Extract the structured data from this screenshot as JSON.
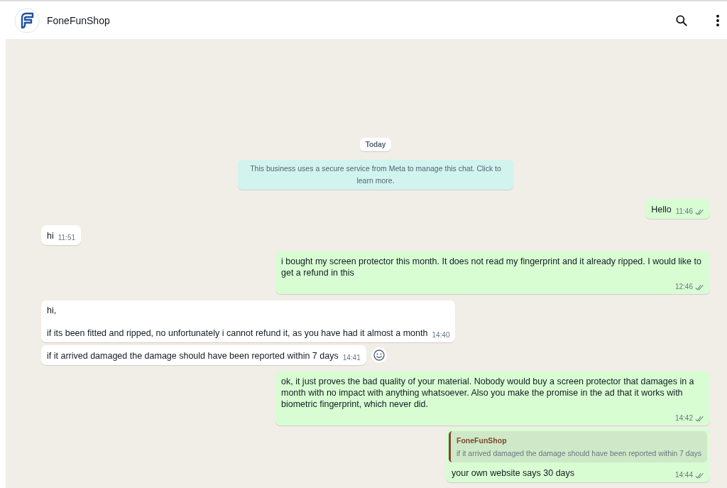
{
  "header": {
    "name": "FoneFunShop"
  },
  "date_chip": "Today",
  "notice": "This business uses a secure service from Meta to manage this chat. Click to learn more.",
  "messages": [
    {
      "kind": "sent",
      "text": "Hello",
      "time": "11:46",
      "read": true
    },
    {
      "kind": "received",
      "text": "hi",
      "time": "11:51"
    },
    {
      "kind": "sent",
      "text": "i bought my screen protector this month. It does not read my fingerprint and it already ripped. I would like to get a refund in this",
      "time": "12:46",
      "read": true
    },
    {
      "kind": "received",
      "text": "hi,\n\nif its been fitted and ripped, no unfortunately i cannot refund it, as you have had it almost a month",
      "time": "14:40"
    },
    {
      "kind": "received",
      "text": "if it arrived damaged the damage should have been reported within 7 days",
      "time": "14:41",
      "reaction_button": true
    },
    {
      "kind": "sent",
      "text": "ok, it just proves the bad quality of your material. Nobody would buy a screen protector that damages in a month with no impact with anything whatsoever. Also you make the promise in the ad that it works with biometric fingerprint, which never did.",
      "time": "14:42",
      "read": true
    },
    {
      "kind": "sent",
      "quote": {
        "author": "FoneFunShop",
        "text": "if it arrived damaged the damage should have been reported within 7 days"
      },
      "text": "your own website says 30 days",
      "time": "14:44",
      "read": true
    }
  ]
}
